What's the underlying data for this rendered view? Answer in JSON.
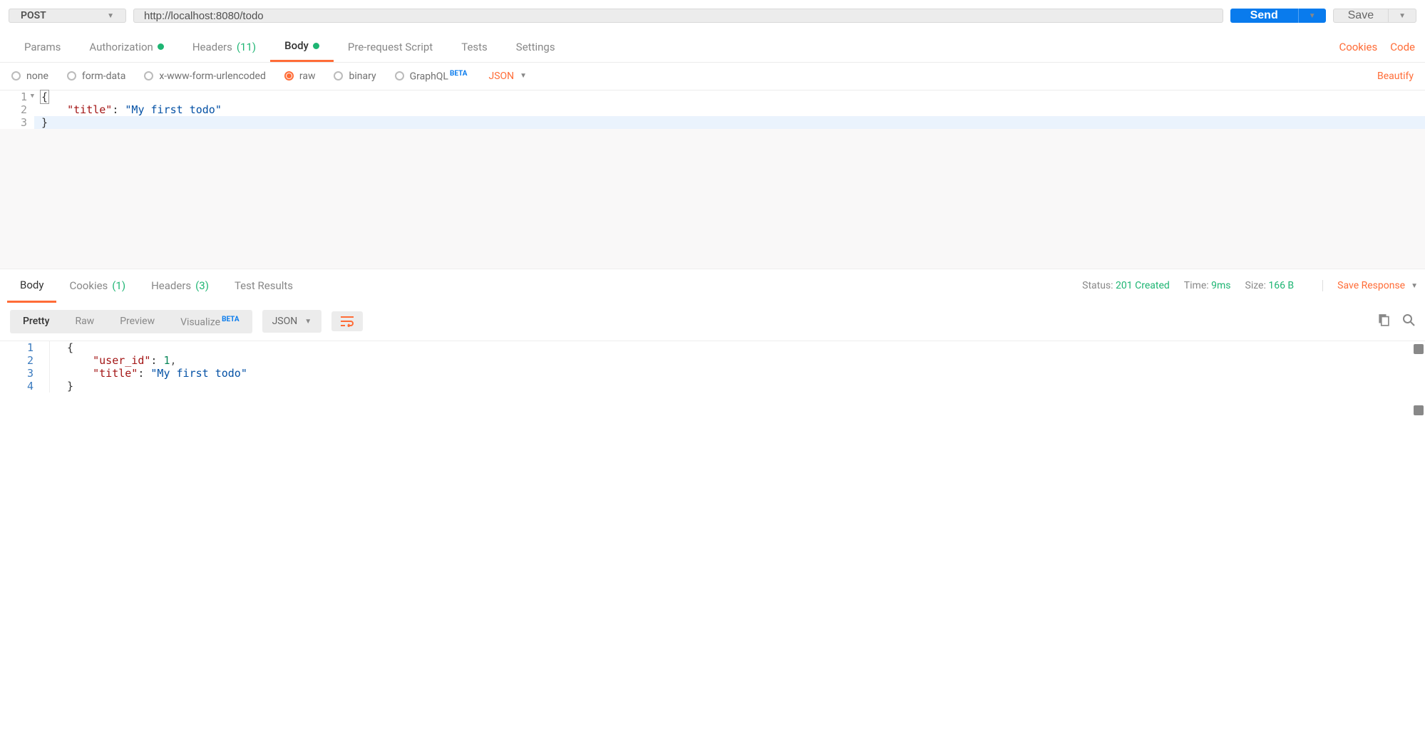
{
  "request": {
    "method": "POST",
    "url": "http://localhost:8080/todo",
    "send": "Send",
    "save": "Save"
  },
  "tabs": {
    "params": "Params",
    "authorization": "Authorization",
    "headers": "Headers",
    "headers_count": "(11)",
    "body": "Body",
    "prerequest": "Pre-request Script",
    "tests": "Tests",
    "settings": "Settings",
    "cookies": "Cookies",
    "code": "Code"
  },
  "body_types": {
    "none": "none",
    "formdata": "form-data",
    "urlencoded": "x-www-form-urlencoded",
    "raw": "raw",
    "binary": "binary",
    "graphql": "GraphQL",
    "beta": "BETA",
    "json": "JSON",
    "beautify": "Beautify"
  },
  "request_body": {
    "l1": "{",
    "l2_key": "\"title\"",
    "l2_sep": ": ",
    "l2_val": "\"My first todo\"",
    "l3": "}"
  },
  "resp_tabs": {
    "body": "Body",
    "cookies": "Cookies",
    "cookies_count": "(1)",
    "headers": "Headers",
    "headers_count": "(3)",
    "test_results": "Test Results"
  },
  "resp_meta": {
    "status_label": "Status:",
    "status_val": "201 Created",
    "time_label": "Time:",
    "time_val": "9ms",
    "size_label": "Size:",
    "size_val": "166 B",
    "save_response": "Save Response"
  },
  "pretty_bar": {
    "pretty": "Pretty",
    "raw": "Raw",
    "preview": "Preview",
    "visualize": "Visualize",
    "beta": "BETA",
    "json": "JSON"
  },
  "response_body": {
    "l1": "{",
    "l2_key": "\"user_id\"",
    "l2_sep": ": ",
    "l2_val": "1",
    "l2_comma": ",",
    "l3_key": "\"title\"",
    "l3_sep": ": ",
    "l3_val": "\"My first todo\"",
    "l4": "}"
  }
}
